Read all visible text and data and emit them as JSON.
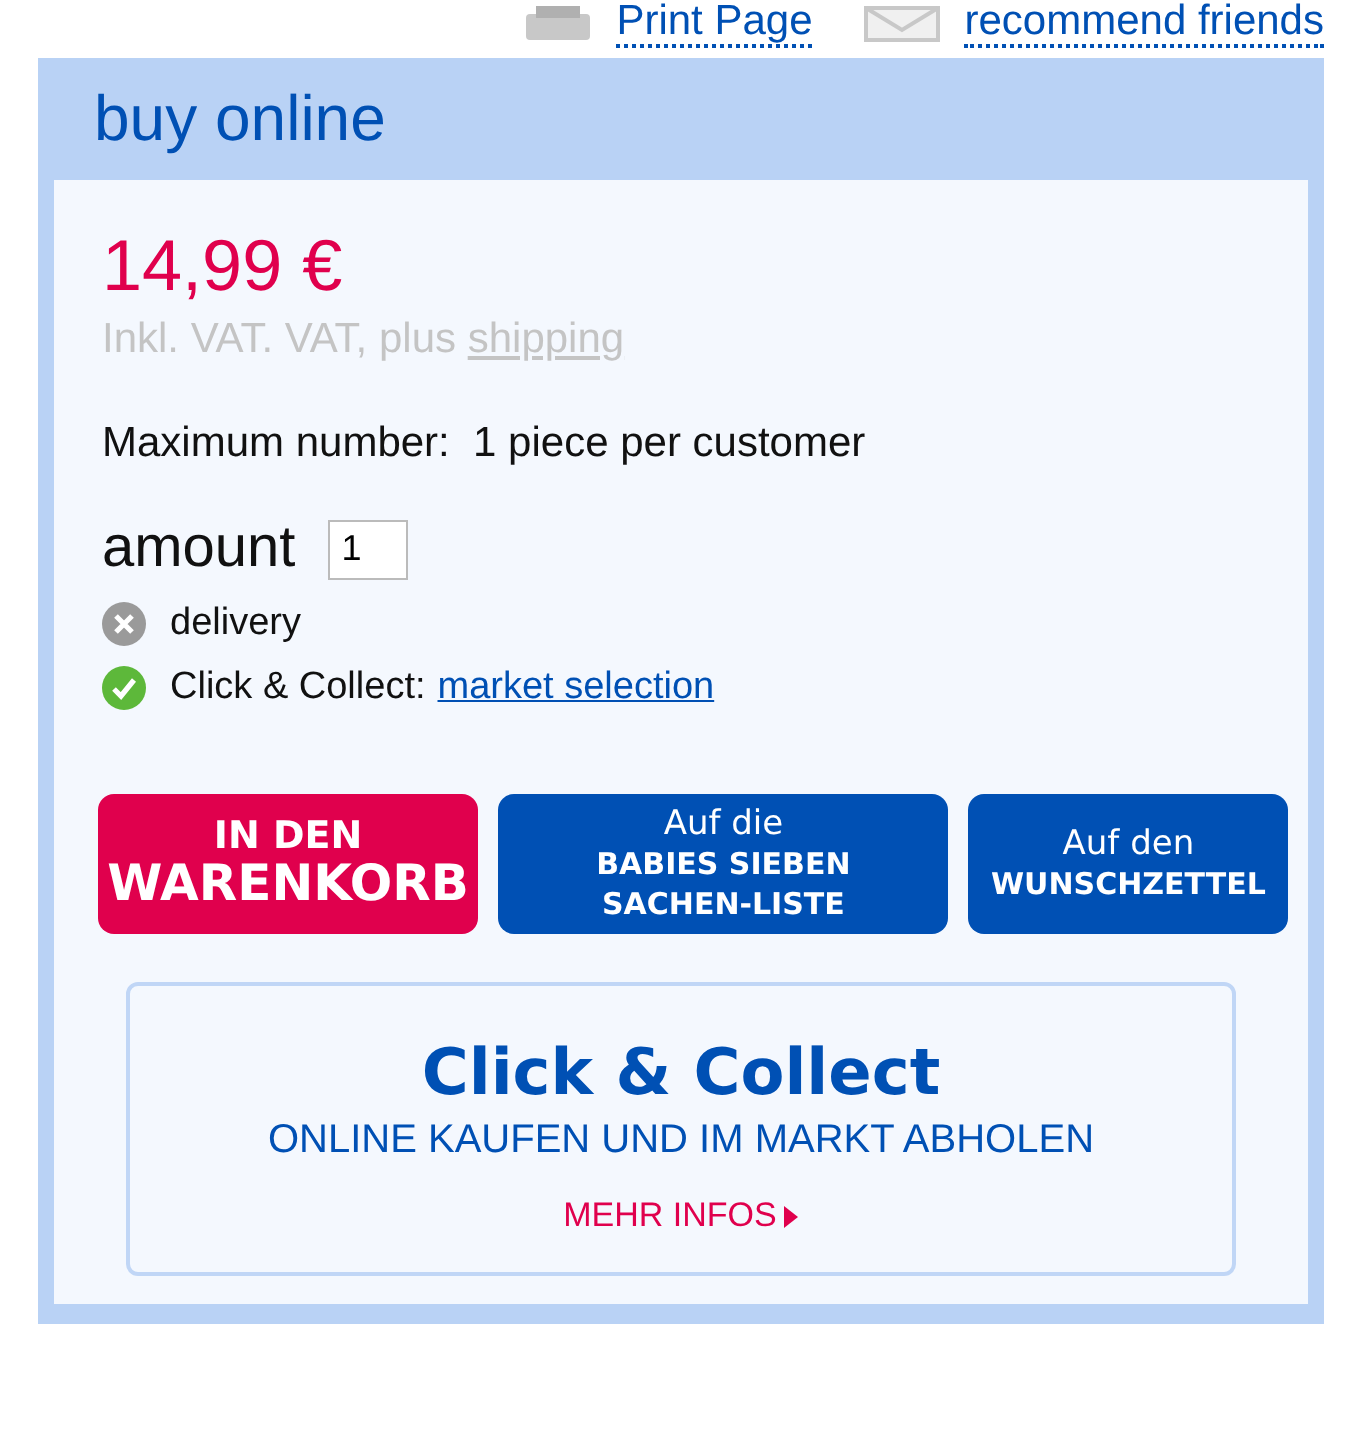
{
  "top_links": [
    {
      "kind": "print",
      "label": "Print Page"
    },
    {
      "kind": "mail",
      "label": "recommend friends"
    }
  ],
  "panel": {
    "title": "buy online",
    "price": "14,99 €",
    "tax_note": "Inkl. VAT. VAT, plus ",
    "tax_link": "shipping",
    "max_label": "Maximum number:",
    "max_value": "1 piece per customer",
    "amount_label": "amount",
    "amount_value": "1",
    "availability": [
      {
        "label": "delivery",
        "available": false
      },
      {
        "label": "Click & Collect:",
        "link": "market selection",
        "available": true
      }
    ],
    "buttons": [
      {
        "kind": "cart",
        "lines": [
          "IN DEN",
          "WARENKORB"
        ]
      },
      {
        "kind": "list",
        "lines": [
          "Auf die",
          "BABIES SIEBEN",
          "SACHEN-LISTE"
        ]
      },
      {
        "kind": "list",
        "lines": [
          "Auf den",
          "WUNSCHZETTEL"
        ]
      }
    ],
    "banner": {
      "title": "Click & Collect",
      "subtitle": "ONLINE KAUFEN UND IM MARKT ABHOLEN",
      "link": "MEHR INFOS"
    }
  }
}
